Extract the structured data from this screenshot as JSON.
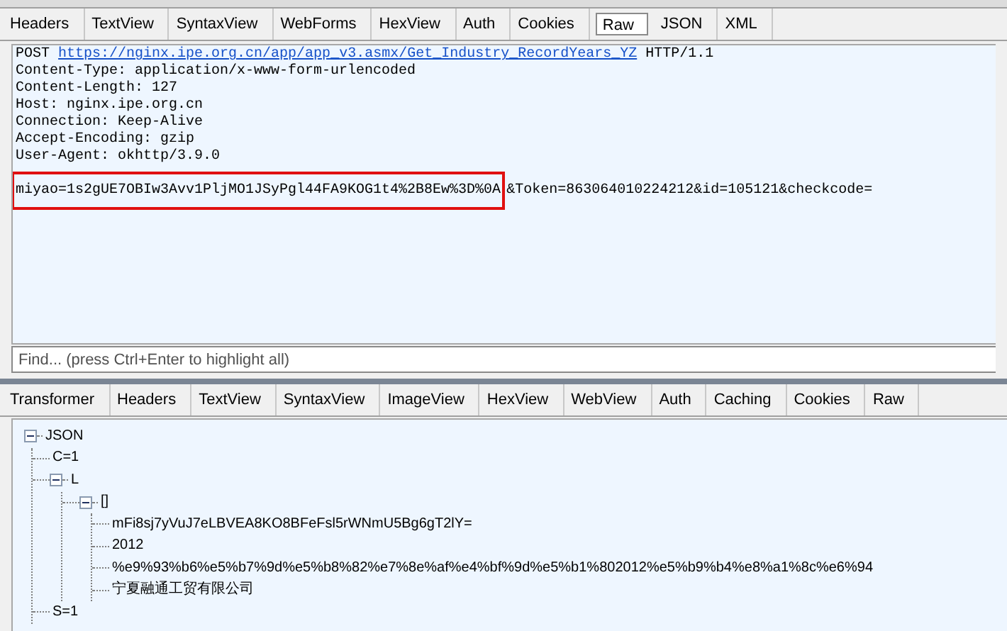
{
  "request_tabs": [
    {
      "label": "Headers",
      "selected": false
    },
    {
      "label": "TextView",
      "selected": false
    },
    {
      "label": "SyntaxView",
      "selected": false
    },
    {
      "label": "WebForms",
      "selected": false
    },
    {
      "label": "HexView",
      "selected": false
    },
    {
      "label": "Auth",
      "selected": false
    },
    {
      "label": "Cookies",
      "selected": false
    },
    {
      "label": "Raw",
      "selected": true
    },
    {
      "label": "JSON",
      "selected": false
    },
    {
      "label": "XML",
      "selected": false
    }
  ],
  "raw_request": {
    "method": "POST",
    "url": "https://nginx.ipe.org.cn/app/app_v3.asmx/Get_Industry_RecordYears_YZ",
    "protocol": "HTTP/1.1",
    "headers": [
      "Content-Type: application/x-www-form-urlencoded",
      "Content-Length: 127",
      "Host: nginx.ipe.org.cn",
      "Connection: Keep-Alive",
      "Accept-Encoding: gzip",
      "User-Agent: okhttp/3.9.0"
    ],
    "body_highlighted": "miyao=1s2gUE7OBIw3Avv1PljMO1JSyPgl44FA9KOG1t4%2B8Ew%3D%0A",
    "body_rest": "&Token=863064010224212&id=105121&checkcode="
  },
  "find": {
    "placeholder": "Find... (press Ctrl+Enter to highlight all)"
  },
  "response_tabs": [
    {
      "label": "Transformer",
      "selected": false
    },
    {
      "label": "Headers",
      "selected": false
    },
    {
      "label": "TextView",
      "selected": false
    },
    {
      "label": "SyntaxView",
      "selected": false
    },
    {
      "label": "ImageView",
      "selected": false
    },
    {
      "label": "HexView",
      "selected": false
    },
    {
      "label": "WebView",
      "selected": false
    },
    {
      "label": "Auth",
      "selected": false
    },
    {
      "label": "Caching",
      "selected": false
    },
    {
      "label": "Cookies",
      "selected": false
    },
    {
      "label": "Raw",
      "selected": false
    }
  ],
  "tree": [
    {
      "label": "JSON",
      "expanded": true,
      "children": [
        {
          "label": "C=1"
        },
        {
          "label": "L",
          "expanded": true,
          "children": [
            {
              "label": "[]",
              "expanded": true,
              "children": [
                {
                  "label": "mFi8sj7yVuJ7eLBVEA8KO8BFeFsl5rWNmU5Bg6gT2lY="
                },
                {
                  "label": "2012"
                },
                {
                  "label": "%e9%93%b6%e5%b7%9d%e5%b8%82%e7%8e%af%e4%bf%9d%e5%b1%802012%e5%b9%b4%e8%a1%8c%e6%94"
                },
                {
                  "label": "宁夏融通工贸有限公司"
                }
              ]
            }
          ]
        },
        {
          "label": "S=1"
        }
      ]
    }
  ]
}
